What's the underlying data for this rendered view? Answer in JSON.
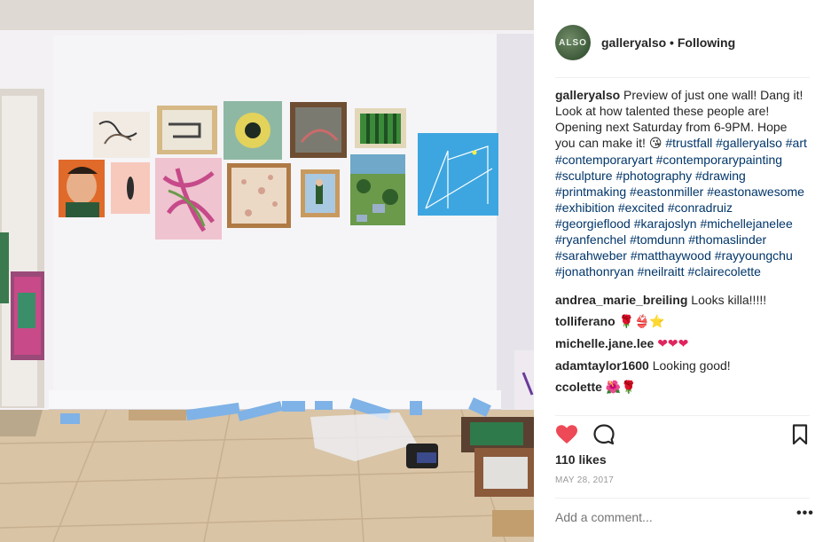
{
  "header": {
    "avatar_text": "ALSO",
    "username": "galleryalso",
    "separator": "•",
    "follow_label": "Following"
  },
  "caption": {
    "username": "galleryalso",
    "text": "Preview of just one wall! Dang it! Look at how talented these people are! Opening next Saturday from 6-9PM. Hope you can make it!",
    "emoji": "😘",
    "hashtags": [
      "#trustfall",
      "#galleryalso",
      "#art",
      "#contemporaryart",
      "#contemporarypainting",
      "#sculpture",
      "#photography",
      "#drawing",
      "#printmaking",
      "#eastonmiller",
      "#eastonawesome",
      "#exhibition",
      "#excited",
      "#conradruiz",
      "#georgieflood",
      "#karajoslyn",
      "#michellejanelee",
      "#ryanfenchel",
      "#tomdunn",
      "#thomaslinder",
      "#sarahweber",
      "#matthaywood",
      "#rayyoungchu",
      "#jonathonryan",
      "#neilraitt",
      "#clairecolette"
    ]
  },
  "comments": [
    {
      "username": "andrea_marie_breiling",
      "text": "Looks killa!!!!!"
    },
    {
      "username": "tolliferano",
      "text": "🌹👙⭐"
    },
    {
      "username": "michelle.jane.lee",
      "text": "❤❤❤"
    },
    {
      "username": "adamtaylor1600",
      "text": "Looking good!"
    },
    {
      "username": "ccolette",
      "text": "🌺🌹"
    }
  ],
  "actions": {
    "like_icon": "heart-icon",
    "comment_icon": "comment-icon",
    "save_icon": "bookmark-icon",
    "like_color": "#ed4956"
  },
  "likes": "110 likes",
  "date": "MAY 28, 2017",
  "add_comment_placeholder": "Add a comment...",
  "more_label": "•••"
}
